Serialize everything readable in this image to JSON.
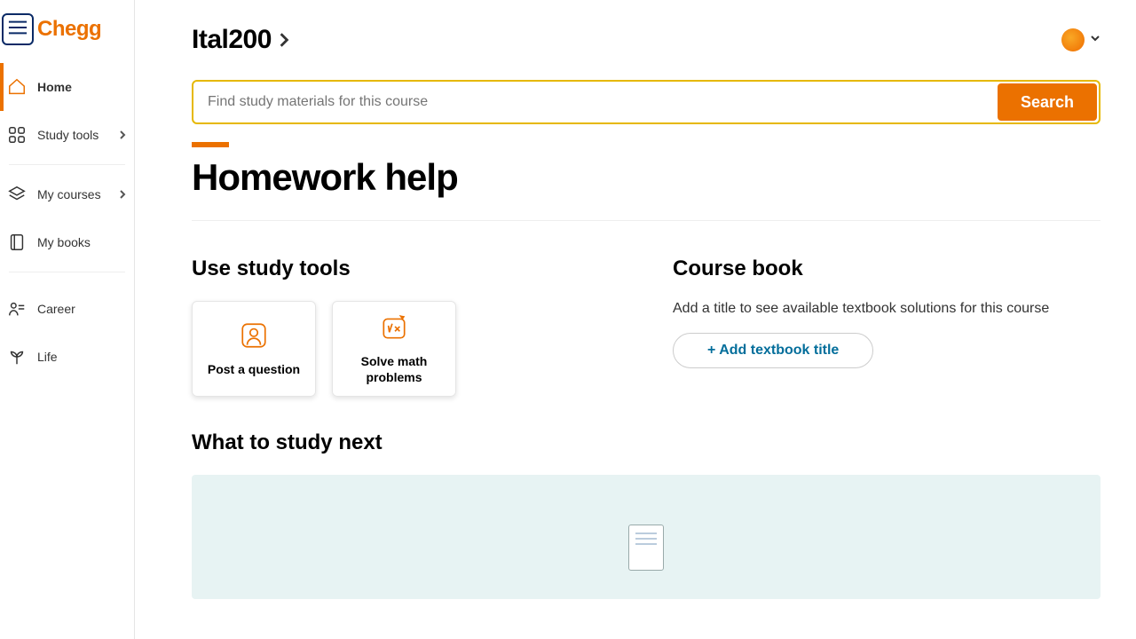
{
  "brand": "Chegg",
  "sidebar": {
    "items": [
      {
        "label": "Home",
        "active": true,
        "has_caret": false
      },
      {
        "label": "Study tools",
        "active": false,
        "has_caret": true
      },
      {
        "label": "My courses",
        "active": false,
        "has_caret": true
      },
      {
        "label": "My books",
        "active": false,
        "has_caret": false
      },
      {
        "label": "Career",
        "active": false,
        "has_caret": false
      },
      {
        "label": "Life",
        "active": false,
        "has_caret": false
      }
    ]
  },
  "header": {
    "course_name": "Ital200"
  },
  "search": {
    "placeholder": "Find study materials for this course",
    "button_label": "Search"
  },
  "page_title": "Homework help",
  "study_tools": {
    "heading": "Use study tools",
    "cards": [
      {
        "label": "Post a question"
      },
      {
        "label": "Solve math problems"
      }
    ]
  },
  "course_book": {
    "heading": "Course book",
    "description": "Add a title to see available textbook solutions for this course",
    "add_button_label": "+ Add textbook title"
  },
  "study_next": {
    "heading": "What to study next"
  }
}
